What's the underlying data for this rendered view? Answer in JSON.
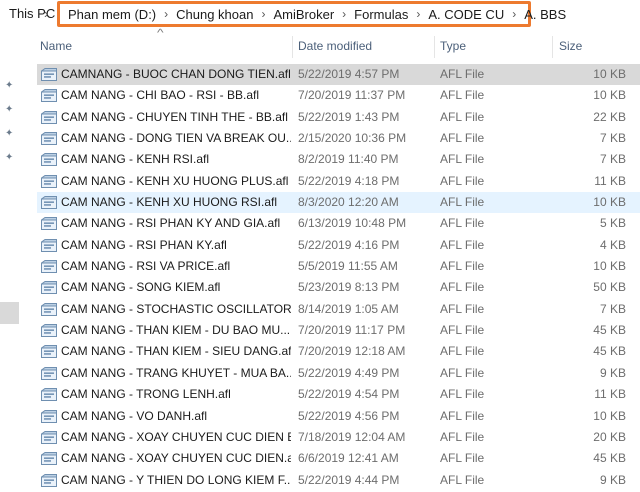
{
  "breadcrumb": {
    "root": "This PC",
    "path": [
      "Phan mem (D:)",
      "Chung khoan",
      "AmiBroker",
      "Formulas",
      "A. CODE CU",
      "A. BBS"
    ],
    "highlight_color": "#ed7a2f"
  },
  "columns": {
    "name": "Name",
    "date": "Date modified",
    "type": "Type",
    "size": "Size"
  },
  "icons": {
    "chevron": "chevron-right-icon",
    "pin": "pin-icon",
    "file": "afl-file-icon",
    "sort": "sort-caret-icon"
  },
  "files": [
    {
      "name": "CAMNANG - BUOC CHAN DONG TIEN.afl",
      "date": "5/22/2019 4:57 PM",
      "type": "AFL File",
      "size": "10 KB",
      "state": "selected"
    },
    {
      "name": "CAM NANG - CHI BAO - RSI - BB.afl",
      "date": "7/20/2019 11:37 PM",
      "type": "AFL File",
      "size": "10 KB",
      "state": ""
    },
    {
      "name": "CAM NANG - CHUYEN TINH THE - BB.afl",
      "date": "5/22/2019 1:43 PM",
      "type": "AFL File",
      "size": "22 KB",
      "state": ""
    },
    {
      "name": "CAM NANG - DONG TIEN VA BREAK OU...",
      "date": "2/15/2020 10:36 PM",
      "type": "AFL File",
      "size": "7 KB",
      "state": ""
    },
    {
      "name": "CAM NANG - KENH RSI.afl",
      "date": "8/2/2019 11:40 PM",
      "type": "AFL File",
      "size": "7 KB",
      "state": ""
    },
    {
      "name": "CAM NANG - KENH XU HUONG PLUS.afl",
      "date": "5/22/2019 4:18 PM",
      "type": "AFL File",
      "size": "11 KB",
      "state": ""
    },
    {
      "name": "CAM NANG - KENH XU HUONG RSI.afl",
      "date": "8/3/2020 12:20 AM",
      "type": "AFL File",
      "size": "10 KB",
      "state": "hover"
    },
    {
      "name": "CAM NANG - RSI PHAN KY AND GIA.afl",
      "date": "6/13/2019 10:48 PM",
      "type": "AFL File",
      "size": "5 KB",
      "state": ""
    },
    {
      "name": "CAM NANG - RSI PHAN KY.afl",
      "date": "5/22/2019 4:16 PM",
      "type": "AFL File",
      "size": "4 KB",
      "state": ""
    },
    {
      "name": "CAM NANG - RSI VA PRICE.afl",
      "date": "5/5/2019 11:55 AM",
      "type": "AFL File",
      "size": "10 KB",
      "state": ""
    },
    {
      "name": "CAM NANG - SONG KIEM.afl",
      "date": "5/23/2019 8:13 PM",
      "type": "AFL File",
      "size": "50 KB",
      "state": ""
    },
    {
      "name": "CAM NANG - STOCHASTIC OSCILLATOR ...",
      "date": "8/14/2019 1:05 AM",
      "type": "AFL File",
      "size": "7 KB",
      "state": ""
    },
    {
      "name": "CAM NANG - THAN KIEM - DU BAO MU...",
      "date": "7/20/2019 11:17 PM",
      "type": "AFL File",
      "size": "45 KB",
      "state": ""
    },
    {
      "name": "CAM NANG - THAN KIEM - SIEU DANG.afl",
      "date": "7/20/2019 12:18 AM",
      "type": "AFL File",
      "size": "45 KB",
      "state": ""
    },
    {
      "name": "CAM NANG - TRANG KHUYET  - MUA BA...",
      "date": "5/22/2019 4:49 PM",
      "type": "AFL File",
      "size": "9 KB",
      "state": ""
    },
    {
      "name": "CAM NANG - TRONG LENH.afl",
      "date": "5/22/2019 4:54 PM",
      "type": "AFL File",
      "size": "11 KB",
      "state": ""
    },
    {
      "name": "CAM NANG - VO DANH.afl",
      "date": "5/22/2019 4:56 PM",
      "type": "AFL File",
      "size": "10 KB",
      "state": ""
    },
    {
      "name": "CAM NANG - XOAY CHUYEN CUC DIEN B...",
      "date": "7/18/2019 12:04 AM",
      "type": "AFL File",
      "size": "20 KB",
      "state": ""
    },
    {
      "name": "CAM NANG - XOAY CHUYEN CUC DIEN.afl",
      "date": "6/6/2019 12:41 AM",
      "type": "AFL File",
      "size": "45 KB",
      "state": ""
    },
    {
      "name": "CAM NANG - Y THIEN DO LONG KIEM F...",
      "date": "5/22/2019 4:44 PM",
      "type": "AFL File",
      "size": "9 KB",
      "state": ""
    }
  ]
}
